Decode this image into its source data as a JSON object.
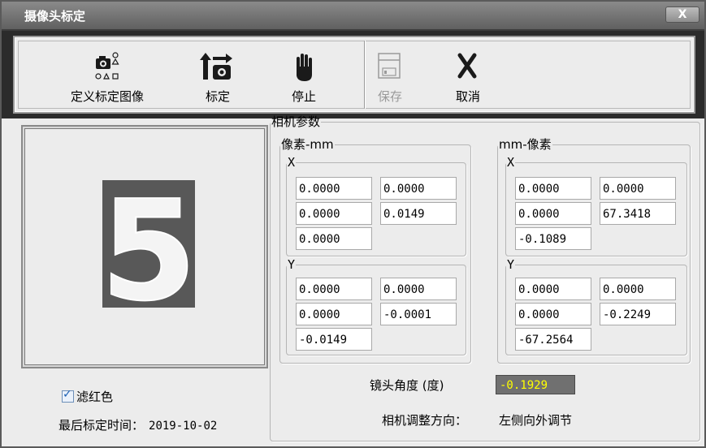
{
  "window": {
    "title": "摄像头标定",
    "close_label": "X"
  },
  "toolbar": {
    "define_label": "定义标定图像",
    "calibrate_label": "标定",
    "stop_label": "停止",
    "save_label": "保存",
    "cancel_label": "取消"
  },
  "preview": {
    "digit": "5"
  },
  "options": {
    "filter_red_label": "滤红色",
    "filter_red_checked": true
  },
  "last_calibration": {
    "label": "最后标定时间：",
    "date": "2019-10-02"
  },
  "camera_params": {
    "title": "相机参数",
    "pixel_to_mm": {
      "title": "像素-mm",
      "x": {
        "label": "X",
        "values": [
          "0.0000",
          "0.0000",
          "0.0000",
          "0.0149",
          "0.0000"
        ]
      },
      "y": {
        "label": "Y",
        "values": [
          "0.0000",
          "0.0000",
          "0.0000",
          "-0.0001",
          "-0.0149"
        ]
      }
    },
    "mm_to_pixel": {
      "title": "mm-像素",
      "x": {
        "label": "X",
        "values": [
          "0.0000",
          "0.0000",
          "0.0000",
          "67.3418",
          "-0.1089"
        ]
      },
      "y": {
        "label": "Y",
        "values": [
          "0.0000",
          "0.0000",
          "0.0000",
          "-0.2249",
          "-67.2564"
        ]
      }
    },
    "lens_angle_label": "镜头角度 (度)",
    "lens_angle_value": "-0.1929",
    "adjust_direction_label": "相机调整方向：",
    "adjust_direction_value": "左侧向外调节"
  },
  "colors": {
    "angle_bg": "#707070",
    "angle_text": "#ffff00",
    "titlebar": "#6e6e6e"
  }
}
